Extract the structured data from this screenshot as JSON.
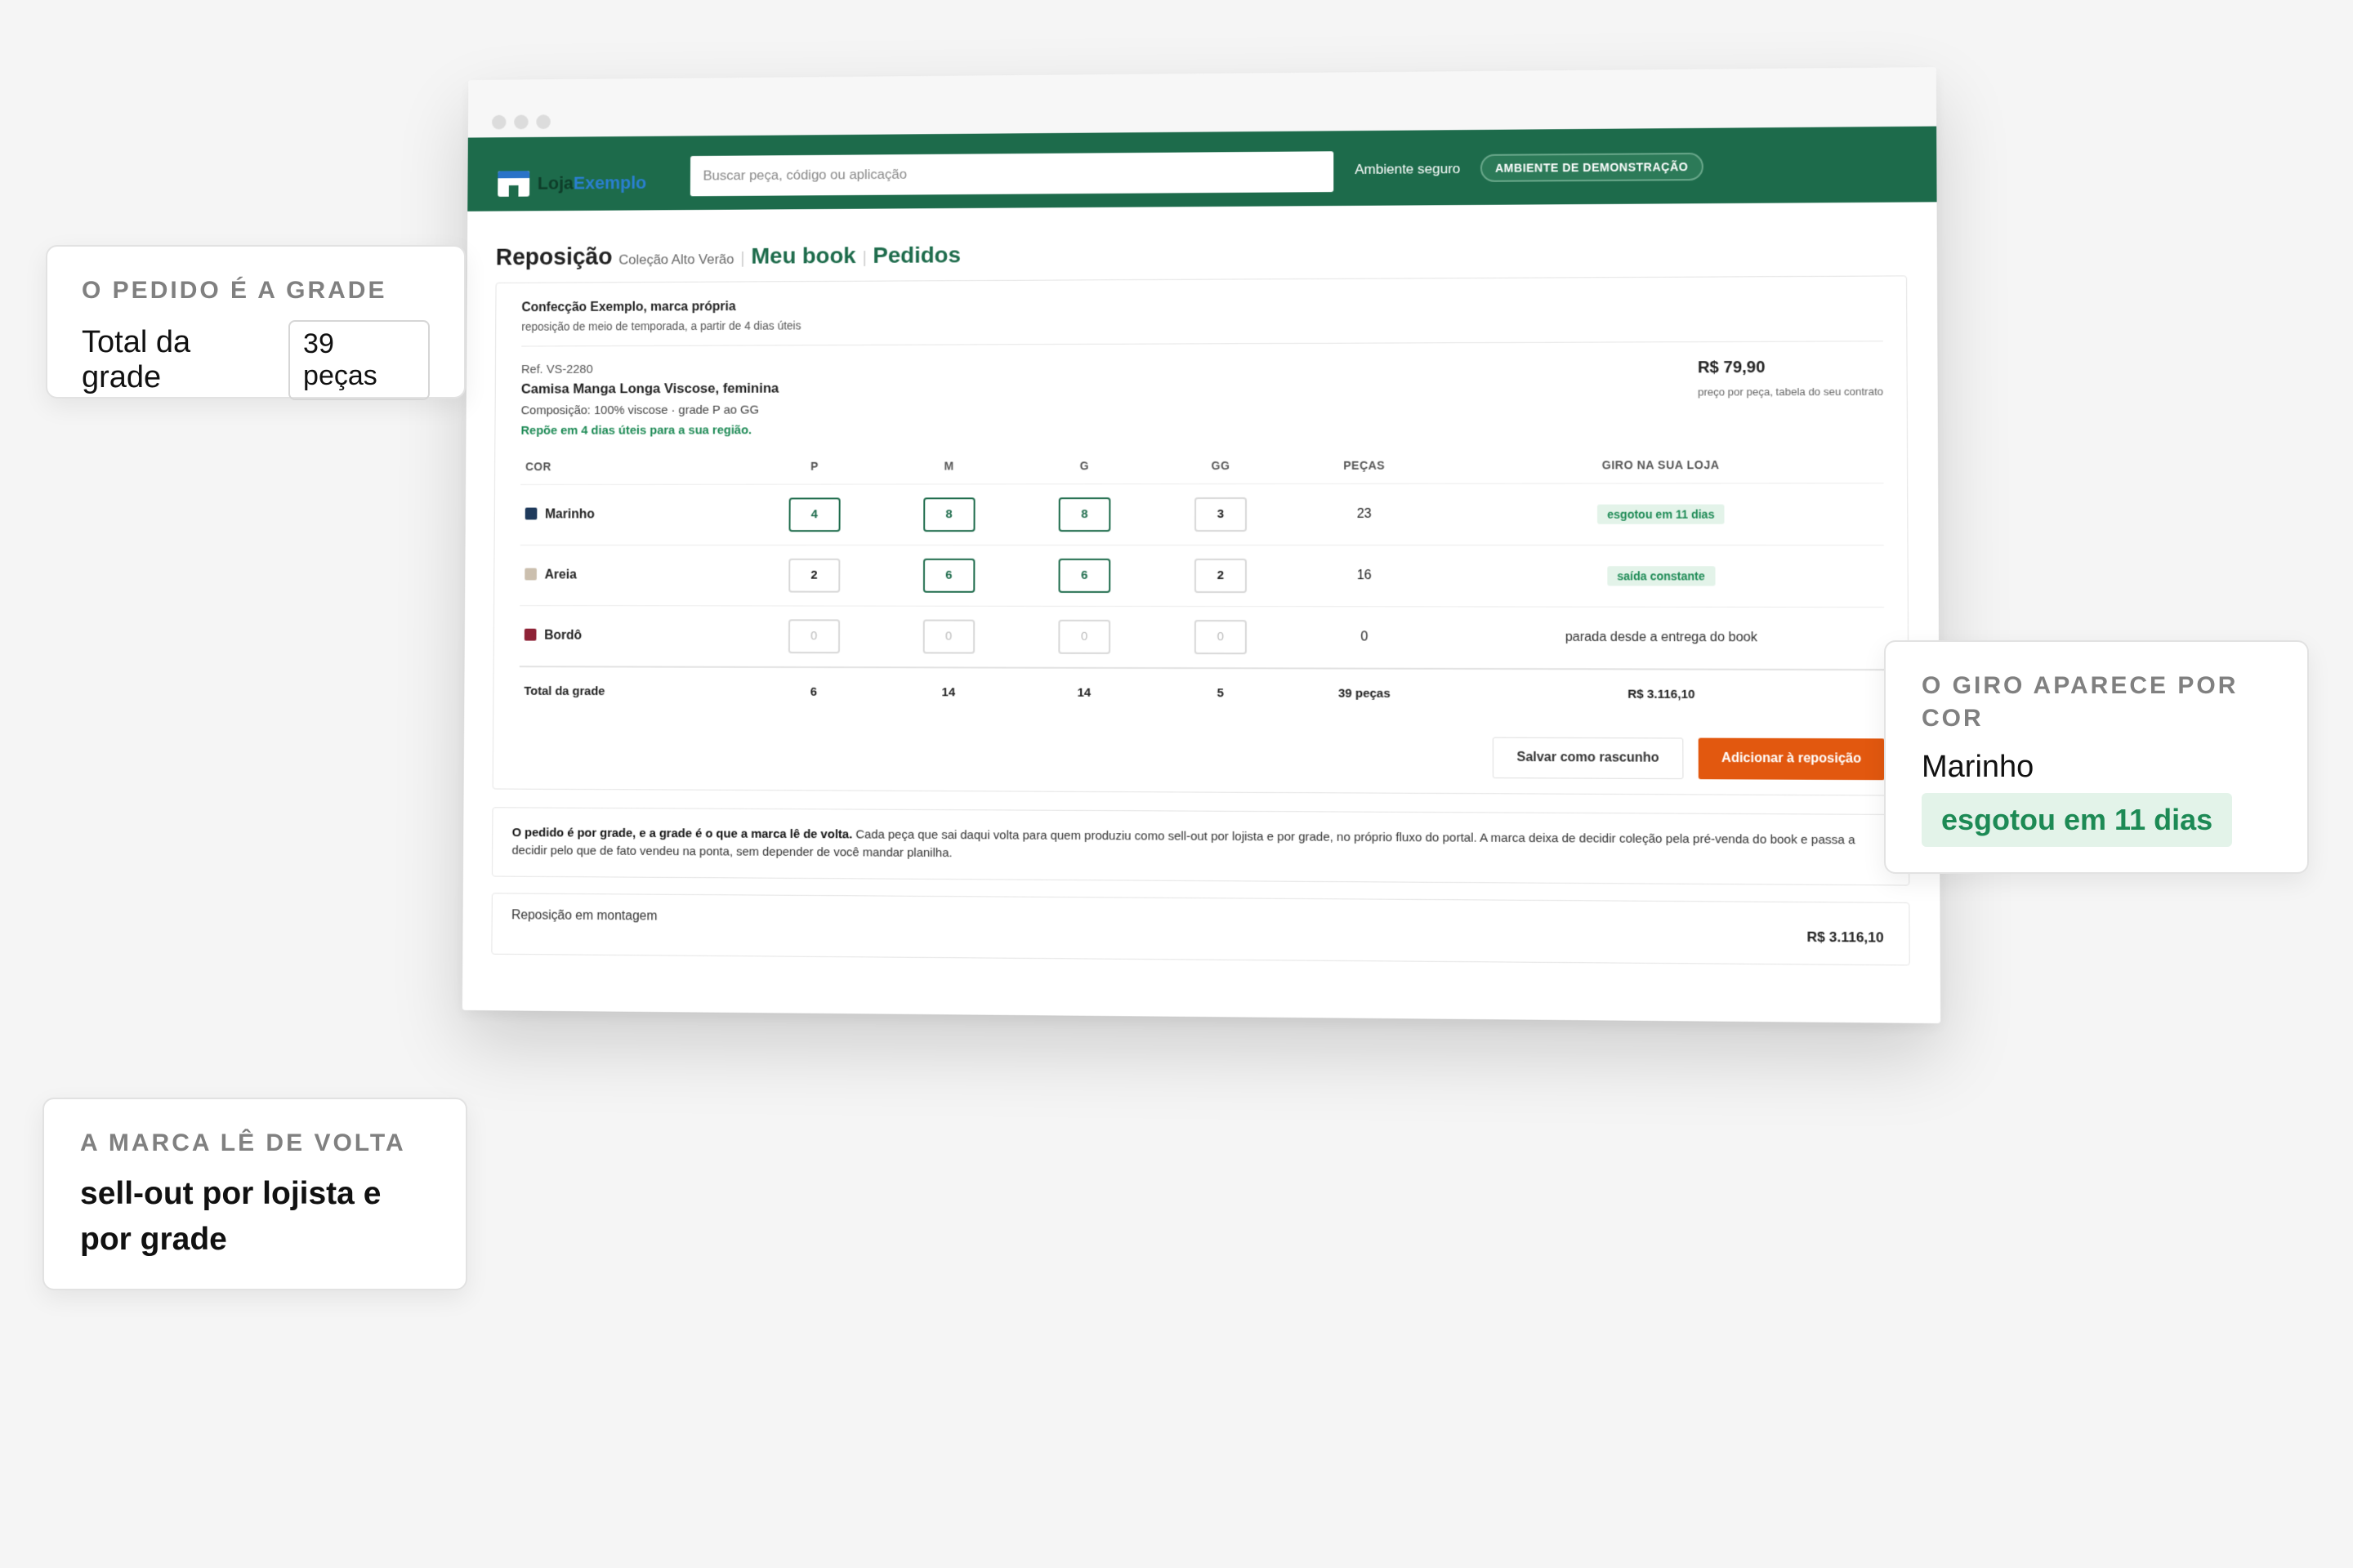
{
  "header": {
    "logo_a": "Loja",
    "logo_b": "Exemplo",
    "search_placeholder": "Buscar peça, código ou aplicação",
    "secure": "Ambiente seguro",
    "demo_badge": "AMBIENTE DE DEMONSTRAÇÃO"
  },
  "page": {
    "title": "Reposição",
    "subtitle": "Coleção Alto Verão",
    "link_book": "Meu book",
    "link_orders": "Pedidos"
  },
  "supplier": {
    "name": "Confecção Exemplo, marca própria",
    "sub": "reposição de meio de temporada, a partir de 4 dias úteis"
  },
  "product": {
    "ref": "Ref. VS-2280",
    "name": "Camisa Manga Longa Viscose, feminina",
    "composition": "Composição: 100% viscose · grade P ao GG",
    "restock": "Repõe em 4 dias úteis para a sua região.",
    "price": "R$ 79,90",
    "price_note": "preço por peça, tabela do seu contrato"
  },
  "grid": {
    "headers": [
      "COR",
      "P",
      "M",
      "G",
      "GG",
      "PEÇAS",
      "GIRO NA SUA LOJA"
    ],
    "rows": [
      {
        "color": "Marinho",
        "swatch": "#1f3a5c",
        "sizes": [
          "4",
          "8",
          "8",
          "3"
        ],
        "pieces": "23",
        "turn": "esgotou em 11 dias"
      },
      {
        "color": "Areia",
        "swatch": "#cbbfae",
        "sizes": [
          "2",
          "6",
          "6",
          "2"
        ],
        "pieces": "16",
        "turn": "saída constante"
      },
      {
        "color": "Bordô",
        "swatch": "#8e2236",
        "sizes": [
          "0",
          "0",
          "0",
          "0"
        ],
        "pieces": "0",
        "turn": "parada desde a entrega do book"
      }
    ],
    "total": {
      "label": "Total da grade",
      "sizes": [
        "6",
        "14",
        "14",
        "5"
      ],
      "pieces": "39 peças",
      "value": "R$ 3.116,10"
    }
  },
  "actions": {
    "draft": "Salvar como rascunho",
    "add": "Adicionar à reposição"
  },
  "note": {
    "bold": "O pedido é por grade, e a grade é o que a marca lê de volta.",
    "text": " Cada peça que sai daqui volta para quem produziu como sell-out por lojista e por grade, no próprio fluxo do portal. A marca deixa de decidir coleção pela pré-venda do book e passa a decidir pelo que de fato vendeu na ponta, sem depender de você mandar planilha."
  },
  "summary": {
    "label": "Reposição em montagem",
    "total": "R$ 3.116,10"
  },
  "callouts": {
    "c1_eyebrow": "O PEDIDO É A GRADE",
    "c1_label": "Total da grade",
    "c1_chip": "39 peças",
    "c2_eyebrow": "O GIRO APARECE POR COR",
    "c2_color": "Marinho",
    "c2_badge": "esgotou em 11 dias",
    "c3_eyebrow": "A MARCA LÊ DE VOLTA",
    "c3_text": "sell-out por lojista e por grade"
  },
  "colors": {
    "brand_green": "#1d6b4b",
    "accent_orange": "#e2580f",
    "positive_green": "#1d8a55"
  }
}
